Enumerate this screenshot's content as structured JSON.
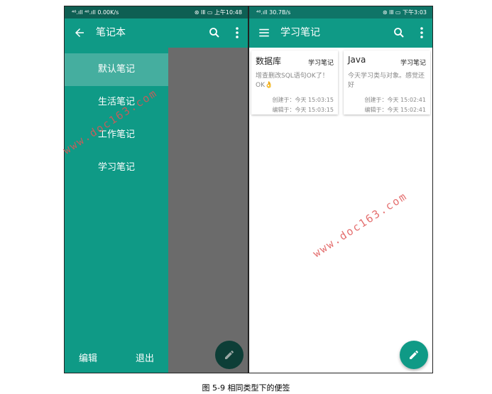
{
  "left_phone": {
    "status_left": "⁴⁶.ıll ⁴⁶.ıll 0.00K/s",
    "status_right": "⊛ ⅠⅡ ▭ 上午10:48",
    "appbar_title": "笔记本",
    "drawer_items": [
      {
        "label": "默认笔记"
      },
      {
        "label": "生活笔记"
      },
      {
        "label": "工作笔记"
      },
      {
        "label": "学习笔记"
      }
    ],
    "edit_label": "编辑",
    "exit_label": "退出"
  },
  "right_phone": {
    "status_left": "⁴⁶.ıll 30.7B/s",
    "status_right": "⊛ ⅠⅡ ▭ 下午3:03",
    "appbar_title": "学习笔记",
    "notes": [
      {
        "title": "数据库",
        "category": "学习笔记",
        "body": "增查删改SQL语句OK了！OK👌",
        "created": "创建于：今天  15:03:15",
        "edited": "编辑于：今天  15:03:15"
      },
      {
        "title": "Java",
        "category": "学习笔记",
        "body": "今天学习类与对象。感觉还好",
        "created": "创建于：今天  15:02:41",
        "edited": "编辑于：今天  15:02:41"
      }
    ]
  },
  "watermark": "www.doc163.com",
  "caption": "图 5-9  相同类型下的便签",
  "colors": {
    "primary": "#0f9a86",
    "primary_dark": "#0e5f53",
    "drawer_selected": "#45ae9f",
    "scrim": "#6b6b6b",
    "watermark": "#e05555"
  },
  "icons": [
    "back-arrow-icon",
    "search-icon",
    "more-vert-icon",
    "menu-icon",
    "pencil-icon"
  ]
}
